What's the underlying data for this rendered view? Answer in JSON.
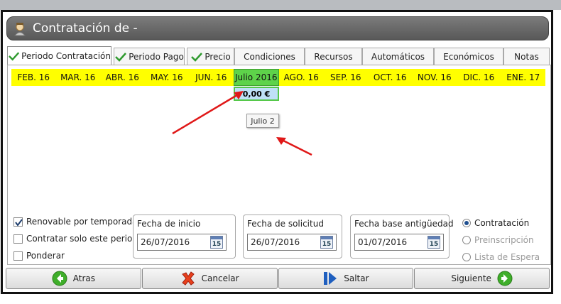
{
  "window": {
    "title": "Contratación de -"
  },
  "tabs": [
    {
      "label": "Periodo Contratación",
      "checked": true,
      "active": true
    },
    {
      "label": "Periodo Pago",
      "checked": true
    },
    {
      "label": "Precio",
      "checked": true
    },
    {
      "label": "Condiciones",
      "checked": false
    },
    {
      "label": "Recursos",
      "checked": false
    },
    {
      "label": "Automáticos",
      "checked": false
    },
    {
      "label": "Económicos",
      "checked": false
    },
    {
      "label": "Notas",
      "checked": false
    }
  ],
  "months": [
    "FEB. 16",
    "MAR. 16",
    "ABR. 16",
    "MAY. 16",
    "JUN. 16",
    "Julio 2016",
    "AGO. 16",
    "SEP. 16",
    "OCT. 16",
    "NOV. 16",
    "DIC. 16",
    "ENE. 17"
  ],
  "selected_month_index": 5,
  "selected_price": "0,00 €",
  "tooltip": "Julio 2",
  "checkboxes": [
    {
      "label": "Renovable por temporadas",
      "checked": true
    },
    {
      "label": "Contratar solo este periodo",
      "checked": false
    },
    {
      "label": "Ponderar",
      "checked": false
    }
  ],
  "dates": {
    "inicio": {
      "label": "Fecha de inicio",
      "value": "26/07/2016"
    },
    "solicitud": {
      "label": "Fecha de solicitud",
      "value": "26/07/2016"
    },
    "antiguedad": {
      "label": "Fecha base antigüedad",
      "value": "01/07/2016"
    },
    "calendar_day": "15"
  },
  "radios": [
    {
      "label": "Contratación",
      "selected": true
    },
    {
      "label": "Preinscripción",
      "selected": false
    },
    {
      "label": "Lista de Espera",
      "selected": false
    }
  ],
  "footer": {
    "atras": "Atras",
    "cancelar": "Cancelar",
    "saltar": "Saltar",
    "siguiente": "Siguiente"
  },
  "colors": {
    "month_bar": "#ffff00",
    "month_selected": "#5ed34a",
    "annotation_arrow": "#e01818"
  }
}
